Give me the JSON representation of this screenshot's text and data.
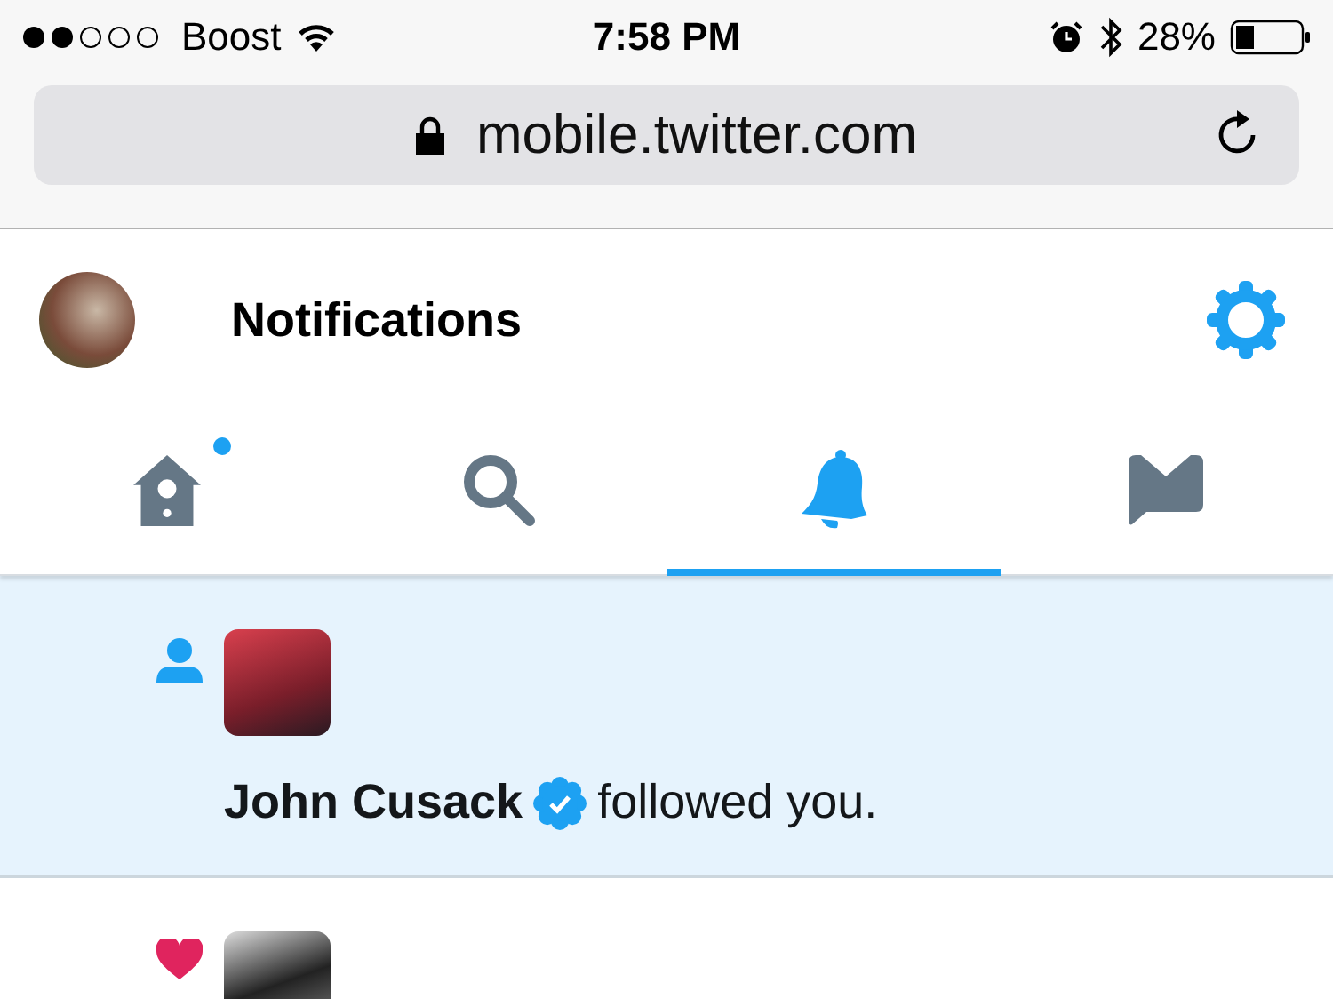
{
  "status_bar": {
    "carrier": "Boost",
    "time": "7:58 PM",
    "battery": "28%"
  },
  "address_bar": {
    "url": "mobile.twitter.com"
  },
  "header": {
    "title": "Notifications"
  },
  "tabs": [
    {
      "kind": "home",
      "selected": false,
      "badge": true
    },
    {
      "kind": "search",
      "selected": false,
      "badge": false
    },
    {
      "kind": "notifications",
      "selected": true,
      "badge": false
    },
    {
      "kind": "messages",
      "selected": false,
      "badge": false
    }
  ],
  "notifications": [
    {
      "kind": "follow",
      "unread": true,
      "name": "John Cusack",
      "verified": true,
      "action": "followed you."
    },
    {
      "kind": "like",
      "unread": false
    }
  ]
}
